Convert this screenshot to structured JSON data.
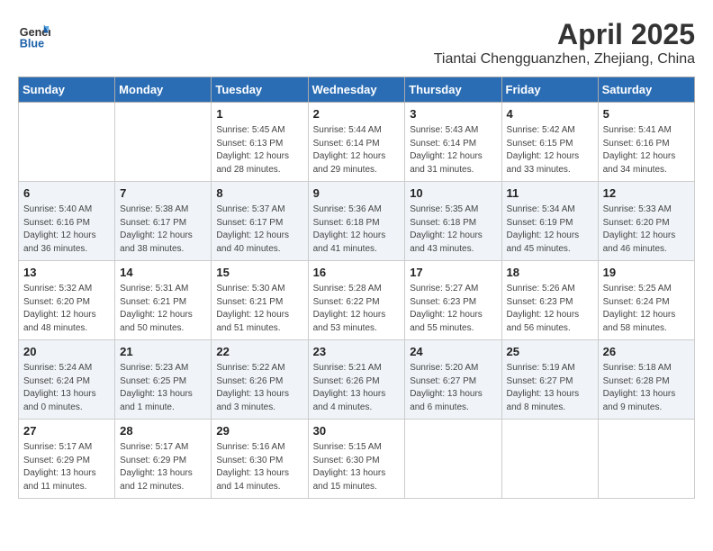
{
  "header": {
    "logo_general": "General",
    "logo_blue": "Blue",
    "month_title": "April 2025",
    "location": "Tiantai Chengguanzhen, Zhejiang, China"
  },
  "weekdays": [
    "Sunday",
    "Monday",
    "Tuesday",
    "Wednesday",
    "Thursday",
    "Friday",
    "Saturday"
  ],
  "weeks": [
    [
      {
        "day": "",
        "info": ""
      },
      {
        "day": "",
        "info": ""
      },
      {
        "day": "1",
        "info": "Sunrise: 5:45 AM\nSunset: 6:13 PM\nDaylight: 12 hours and 28 minutes."
      },
      {
        "day": "2",
        "info": "Sunrise: 5:44 AM\nSunset: 6:14 PM\nDaylight: 12 hours and 29 minutes."
      },
      {
        "day": "3",
        "info": "Sunrise: 5:43 AM\nSunset: 6:14 PM\nDaylight: 12 hours and 31 minutes."
      },
      {
        "day": "4",
        "info": "Sunrise: 5:42 AM\nSunset: 6:15 PM\nDaylight: 12 hours and 33 minutes."
      },
      {
        "day": "5",
        "info": "Sunrise: 5:41 AM\nSunset: 6:16 PM\nDaylight: 12 hours and 34 minutes."
      }
    ],
    [
      {
        "day": "6",
        "info": "Sunrise: 5:40 AM\nSunset: 6:16 PM\nDaylight: 12 hours and 36 minutes."
      },
      {
        "day": "7",
        "info": "Sunrise: 5:38 AM\nSunset: 6:17 PM\nDaylight: 12 hours and 38 minutes."
      },
      {
        "day": "8",
        "info": "Sunrise: 5:37 AM\nSunset: 6:17 PM\nDaylight: 12 hours and 40 minutes."
      },
      {
        "day": "9",
        "info": "Sunrise: 5:36 AM\nSunset: 6:18 PM\nDaylight: 12 hours and 41 minutes."
      },
      {
        "day": "10",
        "info": "Sunrise: 5:35 AM\nSunset: 6:18 PM\nDaylight: 12 hours and 43 minutes."
      },
      {
        "day": "11",
        "info": "Sunrise: 5:34 AM\nSunset: 6:19 PM\nDaylight: 12 hours and 45 minutes."
      },
      {
        "day": "12",
        "info": "Sunrise: 5:33 AM\nSunset: 6:20 PM\nDaylight: 12 hours and 46 minutes."
      }
    ],
    [
      {
        "day": "13",
        "info": "Sunrise: 5:32 AM\nSunset: 6:20 PM\nDaylight: 12 hours and 48 minutes."
      },
      {
        "day": "14",
        "info": "Sunrise: 5:31 AM\nSunset: 6:21 PM\nDaylight: 12 hours and 50 minutes."
      },
      {
        "day": "15",
        "info": "Sunrise: 5:30 AM\nSunset: 6:21 PM\nDaylight: 12 hours and 51 minutes."
      },
      {
        "day": "16",
        "info": "Sunrise: 5:28 AM\nSunset: 6:22 PM\nDaylight: 12 hours and 53 minutes."
      },
      {
        "day": "17",
        "info": "Sunrise: 5:27 AM\nSunset: 6:23 PM\nDaylight: 12 hours and 55 minutes."
      },
      {
        "day": "18",
        "info": "Sunrise: 5:26 AM\nSunset: 6:23 PM\nDaylight: 12 hours and 56 minutes."
      },
      {
        "day": "19",
        "info": "Sunrise: 5:25 AM\nSunset: 6:24 PM\nDaylight: 12 hours and 58 minutes."
      }
    ],
    [
      {
        "day": "20",
        "info": "Sunrise: 5:24 AM\nSunset: 6:24 PM\nDaylight: 13 hours and 0 minutes."
      },
      {
        "day": "21",
        "info": "Sunrise: 5:23 AM\nSunset: 6:25 PM\nDaylight: 13 hours and 1 minute."
      },
      {
        "day": "22",
        "info": "Sunrise: 5:22 AM\nSunset: 6:26 PM\nDaylight: 13 hours and 3 minutes."
      },
      {
        "day": "23",
        "info": "Sunrise: 5:21 AM\nSunset: 6:26 PM\nDaylight: 13 hours and 4 minutes."
      },
      {
        "day": "24",
        "info": "Sunrise: 5:20 AM\nSunset: 6:27 PM\nDaylight: 13 hours and 6 minutes."
      },
      {
        "day": "25",
        "info": "Sunrise: 5:19 AM\nSunset: 6:27 PM\nDaylight: 13 hours and 8 minutes."
      },
      {
        "day": "26",
        "info": "Sunrise: 5:18 AM\nSunset: 6:28 PM\nDaylight: 13 hours and 9 minutes."
      }
    ],
    [
      {
        "day": "27",
        "info": "Sunrise: 5:17 AM\nSunset: 6:29 PM\nDaylight: 13 hours and 11 minutes."
      },
      {
        "day": "28",
        "info": "Sunrise: 5:17 AM\nSunset: 6:29 PM\nDaylight: 13 hours and 12 minutes."
      },
      {
        "day": "29",
        "info": "Sunrise: 5:16 AM\nSunset: 6:30 PM\nDaylight: 13 hours and 14 minutes."
      },
      {
        "day": "30",
        "info": "Sunrise: 5:15 AM\nSunset: 6:30 PM\nDaylight: 13 hours and 15 minutes."
      },
      {
        "day": "",
        "info": ""
      },
      {
        "day": "",
        "info": ""
      },
      {
        "day": "",
        "info": ""
      }
    ]
  ]
}
